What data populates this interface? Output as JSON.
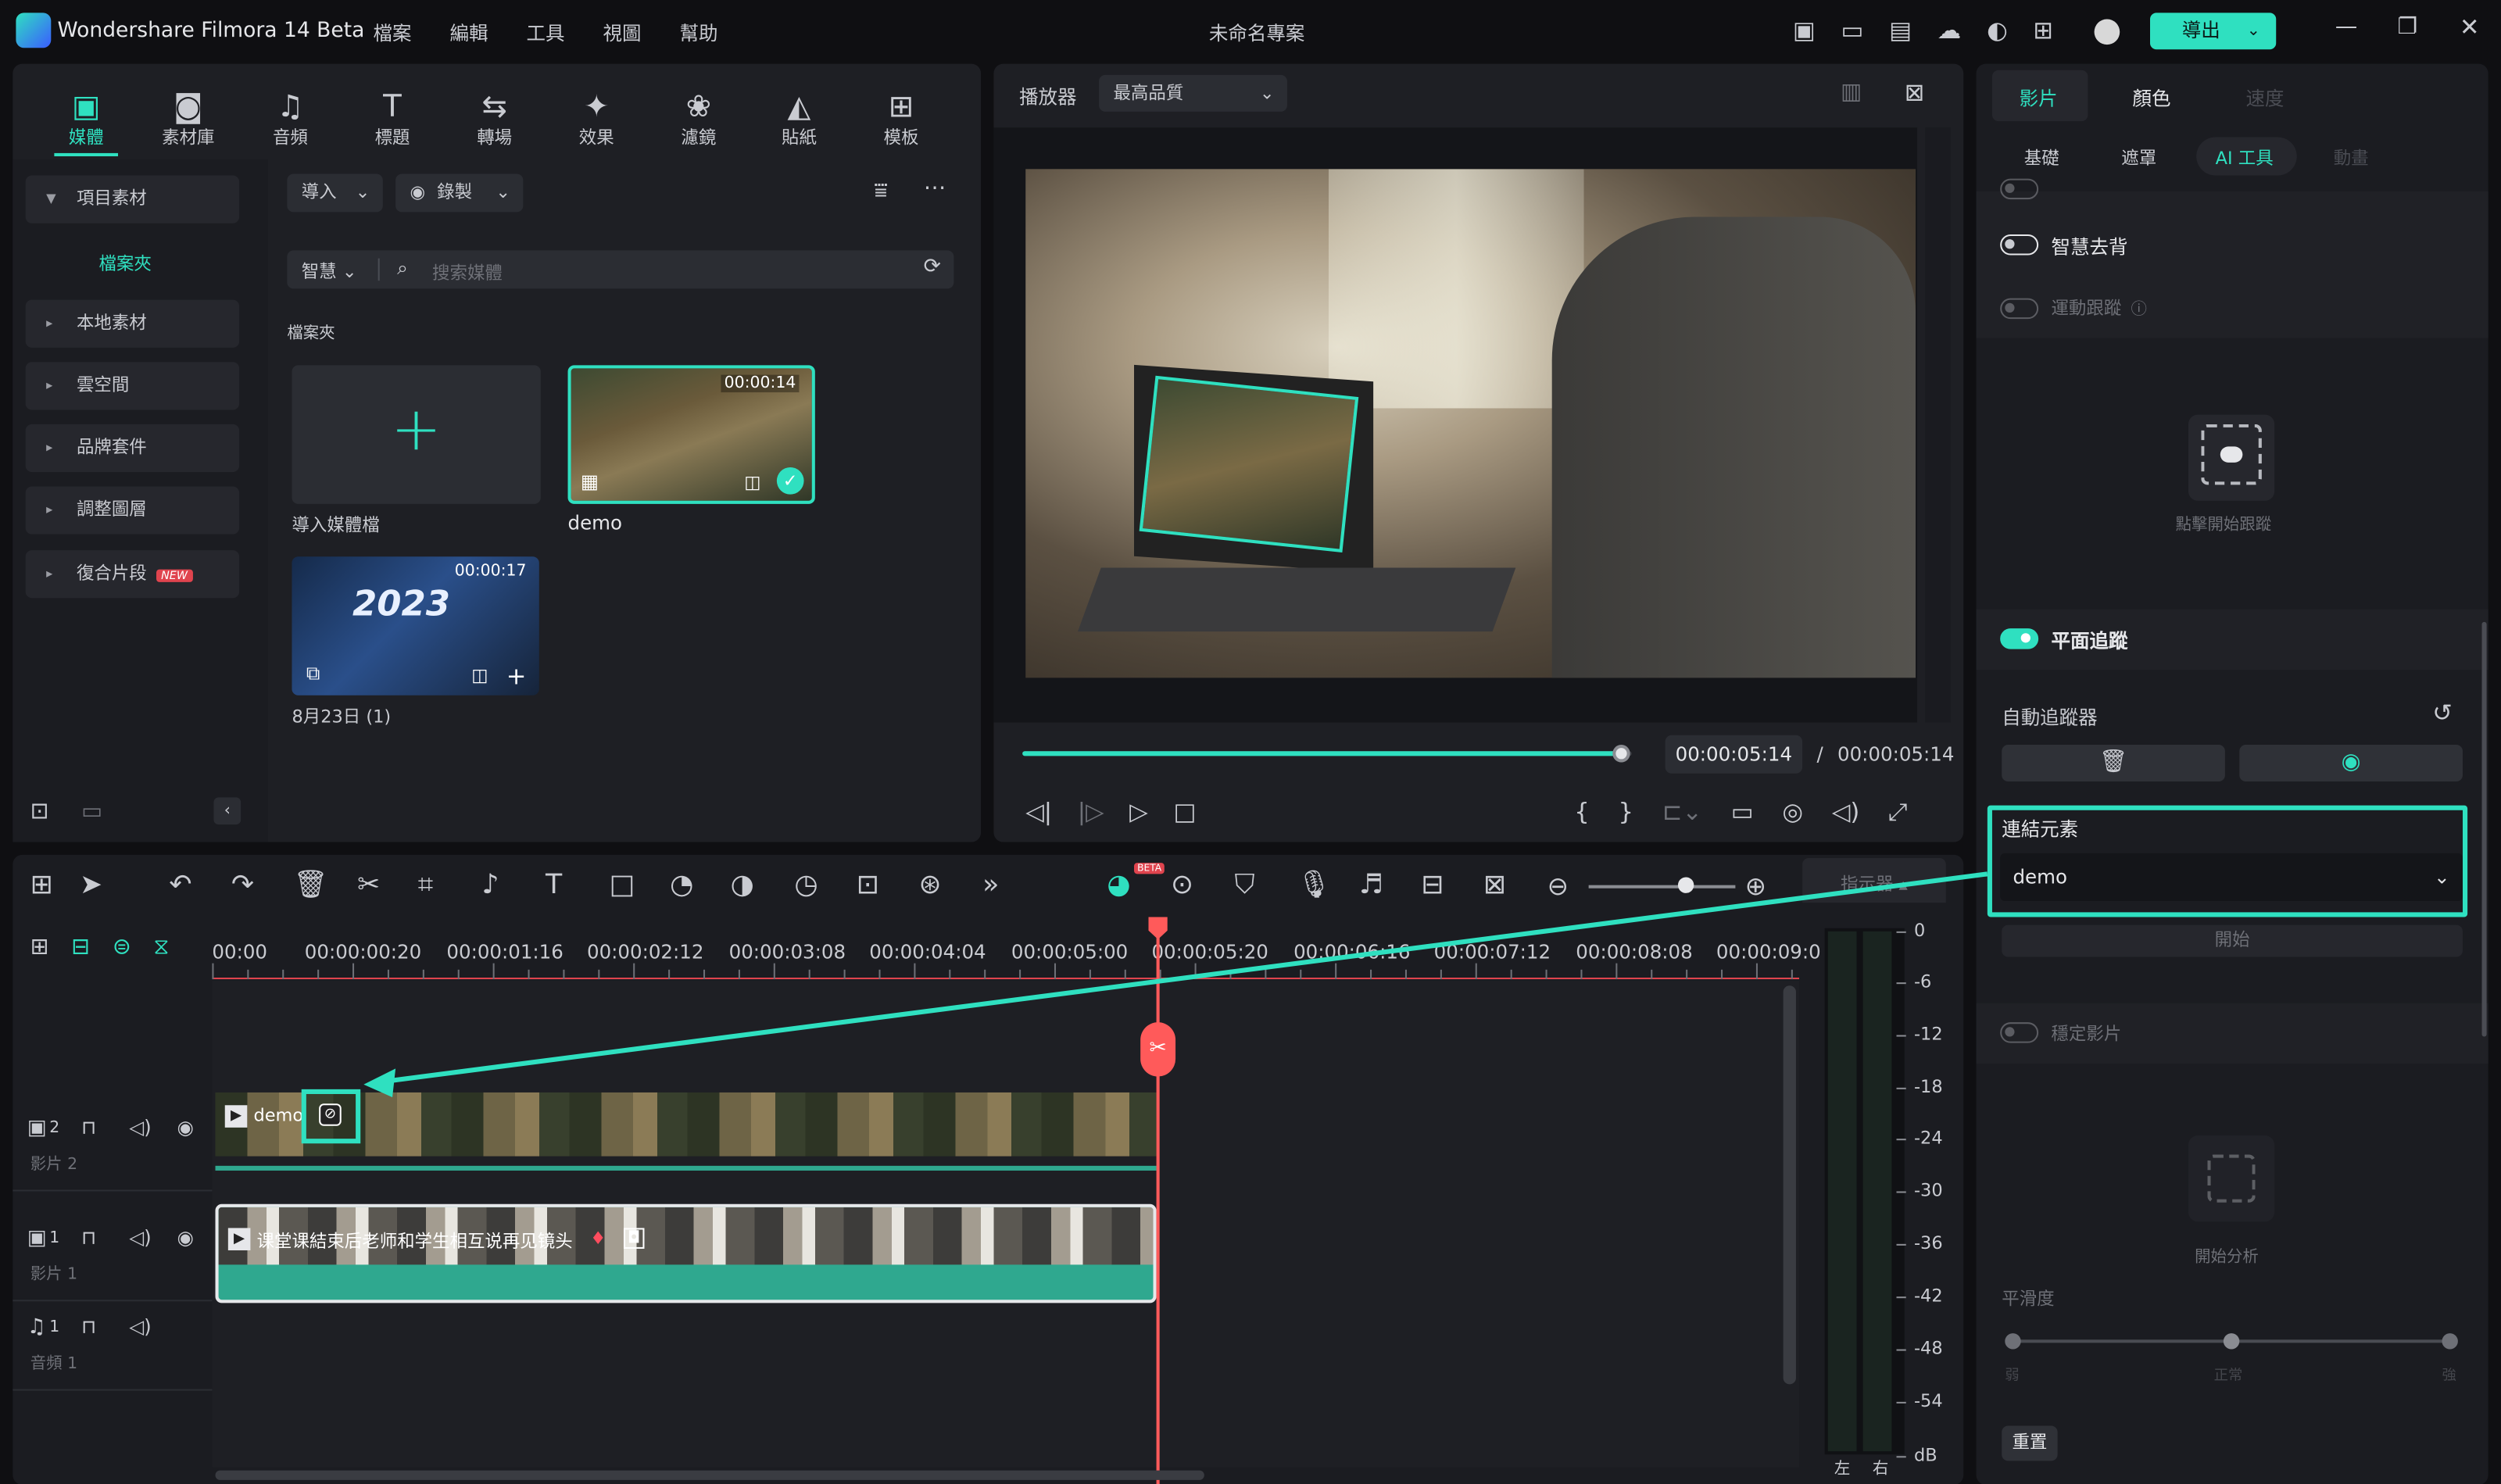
{
  "app": {
    "title": "Wondershare Filmora 14 Beta",
    "project": "未命名專案",
    "export": "導出"
  },
  "menu": [
    "檔案",
    "編輯",
    "工具",
    "視圖",
    "幫助"
  ],
  "media_tabs": [
    {
      "label": "媒體",
      "icon": "media-icon"
    },
    {
      "label": "素材庫",
      "icon": "library-icon"
    },
    {
      "label": "音頻",
      "icon": "music-icon"
    },
    {
      "label": "標題",
      "icon": "title-icon"
    },
    {
      "label": "轉場",
      "icon": "transition-icon"
    },
    {
      "label": "效果",
      "icon": "effect-icon"
    },
    {
      "label": "濾鏡",
      "icon": "filter-icon"
    },
    {
      "label": "貼紙",
      "icon": "sticker-icon"
    },
    {
      "label": "模板",
      "icon": "template-icon"
    }
  ],
  "sidebar": {
    "project": "項目素材",
    "folder": "檔案夾",
    "items": [
      "本地素材",
      "雲空間",
      "品牌套件",
      "調整圖層",
      "復合片段"
    ],
    "new_badge": "NEW"
  },
  "media": {
    "import": "導入",
    "record": "錄製",
    "smart": "智慧",
    "search_placeholder": "搜索媒體",
    "folder_label": "檔案夾",
    "import_tile": "導入媒體檔",
    "clip1": {
      "name": "demo",
      "duration": "00:00:14"
    },
    "clip2": {
      "name": "8月23日 (1)",
      "duration": "00:00:17",
      "overlay": "2023"
    }
  },
  "player": {
    "label": "播放器",
    "quality": "最高品質",
    "current": "00:00:05:14",
    "sep": "/",
    "total": "00:00:05:14",
    "progress": 0.99
  },
  "timeline": {
    "ticks": [
      "00:00",
      "00:00:00:20",
      "00:00:01:16",
      "00:00:02:12",
      "00:00:03:08",
      "00:00:04:04",
      "00:00:05:00",
      "00:00:05:20",
      "00:00:06:16",
      "00:00:07:12",
      "00:00:08:08",
      "00:00:09:0"
    ],
    "tracks": [
      {
        "name": "影片 2",
        "num": "2"
      },
      {
        "name": "影片 1",
        "num": "1"
      },
      {
        "name": "音頻 1",
        "num": "1"
      }
    ],
    "clip_v2": "demo",
    "clip_v1": "课堂课結束后老师和学生相互说再见镜头",
    "meter": {
      "db": [
        "0",
        "-6",
        "-12",
        "-18",
        "-24",
        "-30",
        "-36",
        "-42",
        "-48",
        "-54",
        "dB"
      ],
      "left": "左",
      "right": "右"
    },
    "beta": "BETA",
    "right_btn": "指示器"
  },
  "props": {
    "tabs": [
      "影片",
      "顏色",
      "速度"
    ],
    "subtabs": [
      "基礎",
      "遮罩",
      "AI 工具",
      "動畫"
    ],
    "smart_cutout": "智慧去背",
    "motion_track": "運動跟蹤",
    "click_to_track": "點擊開始跟蹤",
    "planar_track": "平面追蹤",
    "auto_tracker": "自動追蹤器",
    "link_element": "連結元素",
    "link_value": "demo",
    "start": "開始",
    "stabilize": "穩定影片",
    "analyze": "開始分析",
    "smoothness": "平滑度",
    "smooth_labels": [
      "弱",
      "正常",
      "強"
    ],
    "reset": "重置"
  }
}
